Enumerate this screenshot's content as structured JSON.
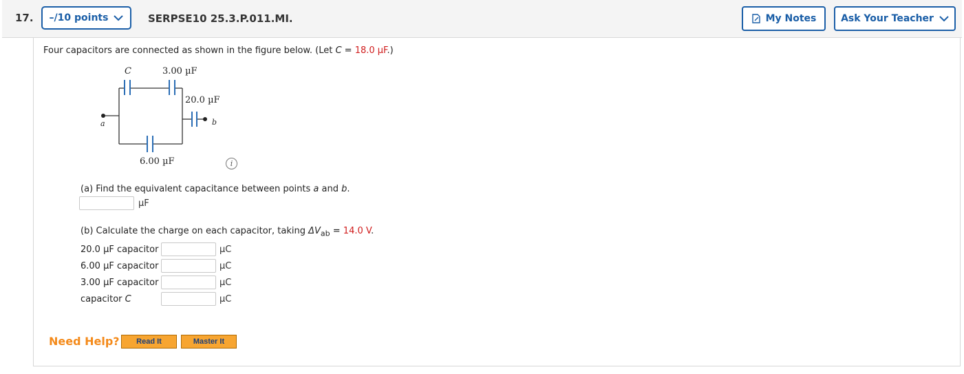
{
  "header": {
    "question_number": "17.",
    "points_label": "–/10 points",
    "question_id": "SERPSE10 25.3.P.011.MI.",
    "my_notes_label": "My Notes",
    "ask_teacher_label": "Ask Your Teacher"
  },
  "prompt": {
    "text_before": "Four capacitors are connected as shown in the figure below. (Let ",
    "var": "C",
    "eq": " = ",
    "value": "18.0 µF",
    "text_after": ".)"
  },
  "figure": {
    "label_c": "C",
    "label_top": "3.00 µF",
    "label_right": "20.0 µF",
    "label_bottom": "6.00 µF",
    "label_a": "a",
    "label_b": "b",
    "info_icon": "i"
  },
  "part_a": {
    "text_before": "(a) Find the equivalent capacitance between points ",
    "a": "a",
    "and": " and ",
    "b": "b",
    "end": ".",
    "unit": "µF",
    "value": ""
  },
  "part_b": {
    "text_before": "(b) Calculate the charge on each capacitor, taking ",
    "delta": "ΔV",
    "sub": "ab",
    "eq": " = ",
    "value": "14.0 V",
    "end": ".",
    "rows": [
      {
        "label": "20.0 µF capacitor",
        "unit": "µC",
        "value": ""
      },
      {
        "label": "6.00 µF capacitor",
        "unit": "µC",
        "value": ""
      },
      {
        "label": "3.00 µF capacitor",
        "unit": "µC",
        "value": ""
      },
      {
        "label": "capacitor ",
        "var": "C",
        "unit": "µC",
        "value": ""
      }
    ]
  },
  "help": {
    "label": "Need Help?",
    "read_it": "Read It",
    "master_it": "Master It"
  },
  "colors": {
    "accent_blue": "#1a5ea7",
    "highlight_red": "#d01c1c",
    "help_orange": "#f48a1a",
    "button_orange": "#f7a531",
    "capacitor_blue": "#2a6db5"
  }
}
